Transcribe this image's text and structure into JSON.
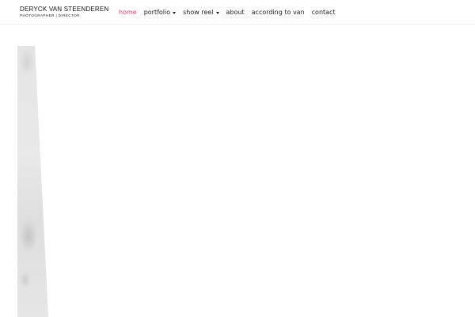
{
  "brand": {
    "name": "DERYCK VAN STEENDEREN",
    "tagline": "PHOTOGRAPHER  |  DIRECTOR"
  },
  "nav": {
    "items": [
      {
        "label": "home",
        "active": true,
        "has_dropdown": false
      },
      {
        "label": "portfolio",
        "active": false,
        "has_dropdown": true
      },
      {
        "label": "show reel",
        "active": false,
        "has_dropdown": true
      },
      {
        "label": "about",
        "active": false,
        "has_dropdown": false
      },
      {
        "label": "according to van",
        "active": false,
        "has_dropdown": false
      },
      {
        "label": "contact",
        "active": false,
        "has_dropdown": false
      }
    ]
  },
  "colors": {
    "active_nav": "#e0406a",
    "nav_text": "#222222",
    "background": "#ffffff"
  }
}
